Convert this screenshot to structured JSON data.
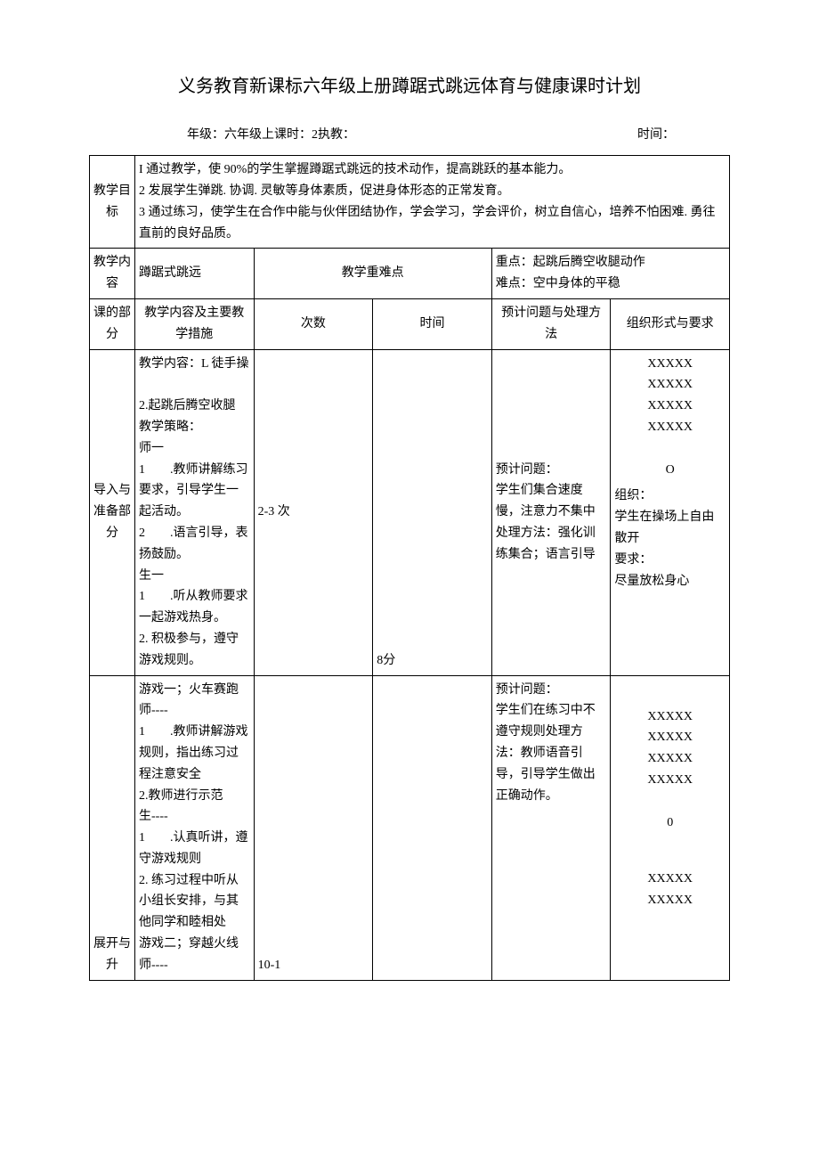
{
  "title": "义务教育新课标六年级上册蹲踞式跳远体育与健康课时计划",
  "meta": {
    "grade_label": "年级：",
    "grade_value": "六年级上",
    "lesson_label": "课时：",
    "lesson_value": "2",
    "teacher_label": "执教：",
    "time_label": "时间："
  },
  "labels": {
    "goal": "教学目标",
    "content": "教学内容",
    "keypoint": "教学重难点",
    "part": "课的部分",
    "measures": "教学内容及主要教学措施",
    "count": "次数",
    "time": "时间",
    "issues": "预计问题与处理方法",
    "org": "组织形式与要求"
  },
  "goal_text": "I 通过教学，使 90%的学生掌握蹲踞式跳远的技术动作，提高跳跃的基本能力。\n2 发展学生弹跳. 协调. 灵敏等身体素质，促进身体形态的正常发育。\n3 通过练习，使学生在合作中能与伙伴团结协作，学会学习，学会评价，树立自信心，培养不怕困难. 勇往直前的良好品质。",
  "content_text": "蹲踞式跳远",
  "keypoint_text": "重点：起跳后腾空收腿动作\n难点：空中身体的平稳",
  "row1": {
    "part": "导入与准备部分",
    "measures": "教学内容：L 徒手操\n\n2.起跳后腾空收腿\n教学策略：\n师一\n1        .教师讲解练习要求，引导学生一起活动。\n2        .语言引导，表扬鼓励。\n生一\n1        .听从教师要求一起游戏热身。\n2. 积极参与，遵守游戏规则。",
    "count": "2-3 次",
    "time": "8分",
    "issues": "预计问题：\n学生们集合速度慢，注意力不集中\n处理方法：强化训练集合；语言引导",
    "org_x": "XXXXX\nXXXXX\nXXXXX\nXXXXX\n\nO",
    "org_text": "组织：\n学生在操场上自由散开\n要求：\n尽量放松身心"
  },
  "row2": {
    "part": "展开与升",
    "measures": "游戏一；火车赛跑\n师----\n1        .教师讲解游戏规则，指出练习过程注意安全\n2.教师进行示范\n生----\n1        .认真听讲，遵守游戏规则\n2. 练习过程中听从小组长安排，与其他同学和睦相处\n游戏二；穿越火线\n师----",
    "count": "10-1",
    "time": "",
    "issues": "预计问题：\n学生们在练习中不遵守规则处理方法：教师语音引导，引导学生做出正确动作。",
    "org_x1": "XXXXX\nXXXXX\nXXXXX\nXXXXX\n\n0",
    "org_x2": "XXXXX\nXXXXX"
  }
}
